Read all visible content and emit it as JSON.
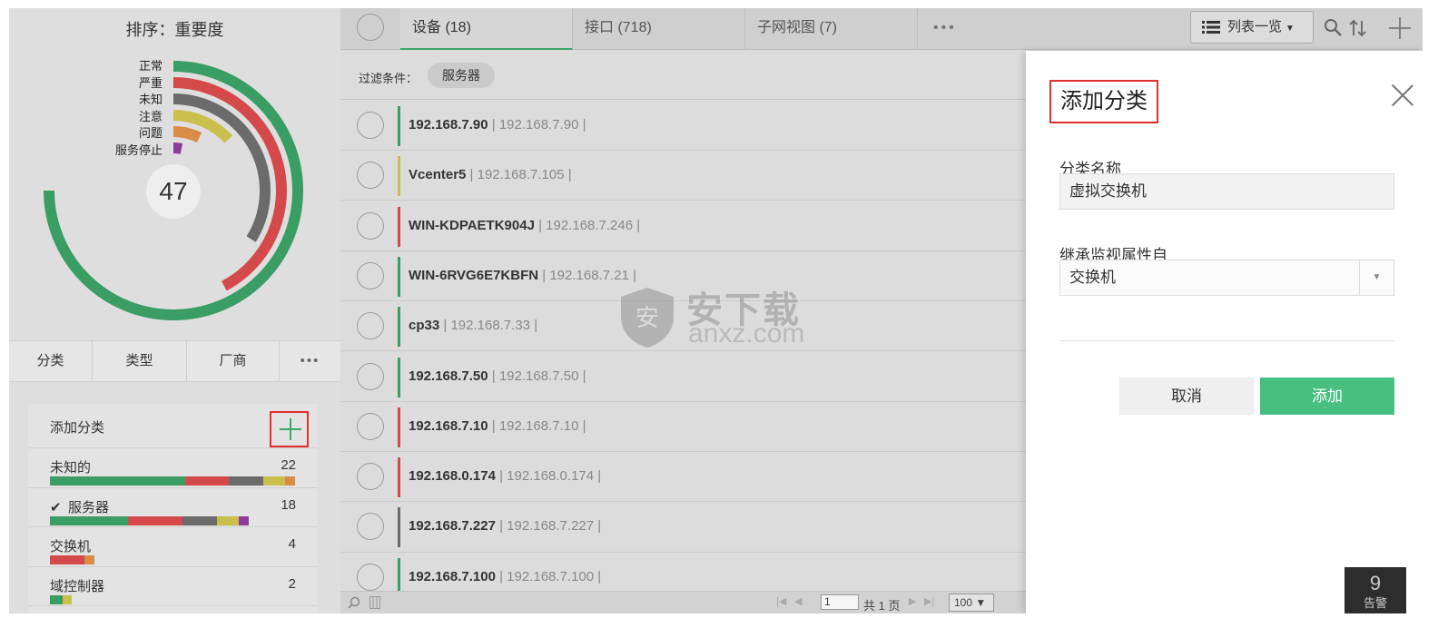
{
  "sort": {
    "title": "排序：重要度"
  },
  "donut": {
    "count": "47",
    "legend": [
      {
        "label": "正常",
        "color": "#3a9d63"
      },
      {
        "label": "严重",
        "color": "#d44a4a"
      },
      {
        "label": "未知",
        "color": "#6b6b6b"
      },
      {
        "label": "注意",
        "color": "#c9bf4a"
      },
      {
        "label": "问题",
        "color": "#d98c45"
      },
      {
        "label": "服务停止",
        "color": "#8b3a9c"
      }
    ]
  },
  "left_tabs": [
    {
      "label": "分类"
    },
    {
      "label": "类型"
    },
    {
      "label": "厂商"
    },
    {
      "label": "•••"
    }
  ],
  "categories": {
    "add_label": "添加分类",
    "items": [
      {
        "name": "未知的",
        "count": "22",
        "checked": false,
        "bar": [
          [
            "#3a9d63",
            0.55
          ],
          [
            "#d44a4a",
            0.18
          ],
          [
            "#6b6b6b",
            0.14
          ],
          [
            "#c9bf4a",
            0.09
          ],
          [
            "#d98c45",
            0.04
          ]
        ]
      },
      {
        "name": "服务器",
        "count": "18",
        "checked": true,
        "bar": [
          [
            "#3a9d63",
            0.32
          ],
          [
            "#d44a4a",
            0.22
          ],
          [
            "#6b6b6b",
            0.14
          ],
          [
            "#c9bf4a",
            0.09
          ],
          [
            "#8b3a9c",
            0.04
          ]
        ]
      },
      {
        "name": "交换机",
        "count": "4",
        "checked": false,
        "bar": [
          [
            "#d44a4a",
            0.14
          ],
          [
            "#d98c45",
            0.04
          ]
        ]
      },
      {
        "name": "域控制器",
        "count": "2",
        "checked": false,
        "bar": [
          [
            "#3a9d63",
            0.05
          ],
          [
            "#c9bf4a",
            0.04
          ]
        ]
      }
    ]
  },
  "top_tabs": [
    {
      "label": "设备 (18)",
      "active": true
    },
    {
      "label": "接口 (718)",
      "active": false
    },
    {
      "label": "子网视图 (7)",
      "active": false
    },
    {
      "label": "•••",
      "active": false
    }
  ],
  "view_button": {
    "label": "列表一览"
  },
  "filter": {
    "label": "过滤条件：",
    "chip": "服务器"
  },
  "devices": [
    {
      "name": "192.168.7.90",
      "ip": "192.168.7.90",
      "status_color": "#3a9d63"
    },
    {
      "name": "Vcenter5",
      "ip": "192.168.7.105",
      "status_color": "#c9bf4a"
    },
    {
      "name": "WIN-KDPAETK904J",
      "ip": "192.168.7.246",
      "status_color": "#d44a4a"
    },
    {
      "name": "WIN-6RVG6E7KBFN",
      "ip": "192.168.7.21",
      "status_color": "#3a9d63"
    },
    {
      "name": "cp33",
      "ip": "192.168.7.33",
      "status_color": "#3a9d63"
    },
    {
      "name": "192.168.7.50",
      "ip": "192.168.7.50",
      "status_color": "#3a9d63"
    },
    {
      "name": "192.168.7.10",
      "ip": "192.168.7.10",
      "status_color": "#d44a4a"
    },
    {
      "name": "192.168.0.174",
      "ip": "192.168.0.174",
      "status_color": "#d44a4a"
    },
    {
      "name": "192.168.7.227",
      "ip": "192.168.7.227",
      "status_color": "#6b6b6b"
    },
    {
      "name": "192.168.7.100",
      "ip": "192.168.7.100",
      "status_color": "#3a9d63"
    }
  ],
  "pagination": {
    "page": "1",
    "total": "共 1 页",
    "page_size": "100 ▼"
  },
  "drawer": {
    "title": "添加分类",
    "name_label": "分类名称",
    "name_value": "虚拟交换机",
    "inherit_label": "继承监视属性自",
    "inherit_value": "交换机",
    "cancel": "取消",
    "add": "添加"
  },
  "alarm": {
    "count": "9",
    "label": "告警"
  },
  "watermark": {
    "line1": "安下载",
    "line2": "anxz.com"
  }
}
